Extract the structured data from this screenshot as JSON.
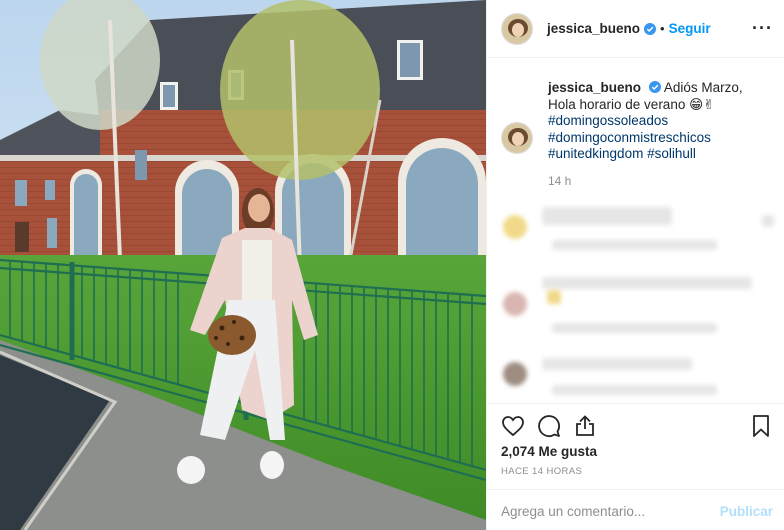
{
  "post": {
    "username": "jessica_bueno",
    "follow_label": "Seguir",
    "separator": "•",
    "more_label": "···"
  },
  "caption": {
    "username": "jessica_bueno",
    "text": "Adiós Marzo, Hola horario de verano 😁✌",
    "hashtags": [
      "#domingossoleados",
      "#domingoconmistreschicos",
      "#unitedkingdom",
      "#solihull"
    ],
    "time": "14 h"
  },
  "stats": {
    "likes": "2,074 Me gusta",
    "posted_ago": "HACE 14 HORAS"
  },
  "comment_box": {
    "placeholder": "Agrega un comentario...",
    "publish_label": "Publicar"
  },
  "icons": {
    "like": "heart-icon",
    "comment": "comment-icon",
    "share": "share-icon",
    "save": "bookmark-icon",
    "verified": "verified-badge-icon"
  },
  "colors": {
    "link": "#0095f6",
    "hashtag": "#00376b",
    "muted": "#8e8e8e",
    "publish_disabled": "#b2dffc"
  }
}
